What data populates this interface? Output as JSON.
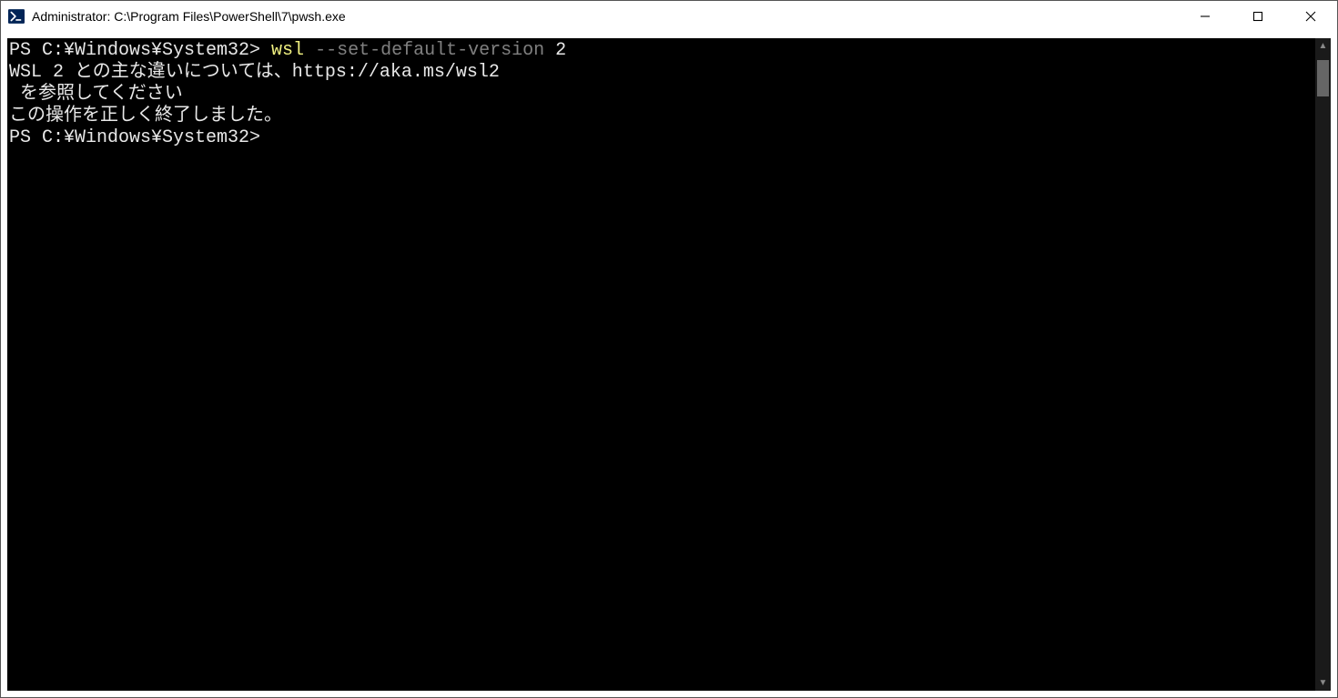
{
  "window": {
    "title": "Administrator: C:\\Program Files\\PowerShell\\7\\pwsh.exe"
  },
  "terminal": {
    "line1_prompt": "PS C:¥Windows¥System32> ",
    "line1_cmd": "wsl",
    "line1_arg": " --set-default-version ",
    "line1_val": "2",
    "line2": "WSL 2 との主な違いについては、https://aka.ms/wsl2",
    "line3": " を参照してください",
    "line4": "この操作を正しく終了しました。",
    "line5_prompt": "PS C:¥Windows¥System32>"
  }
}
